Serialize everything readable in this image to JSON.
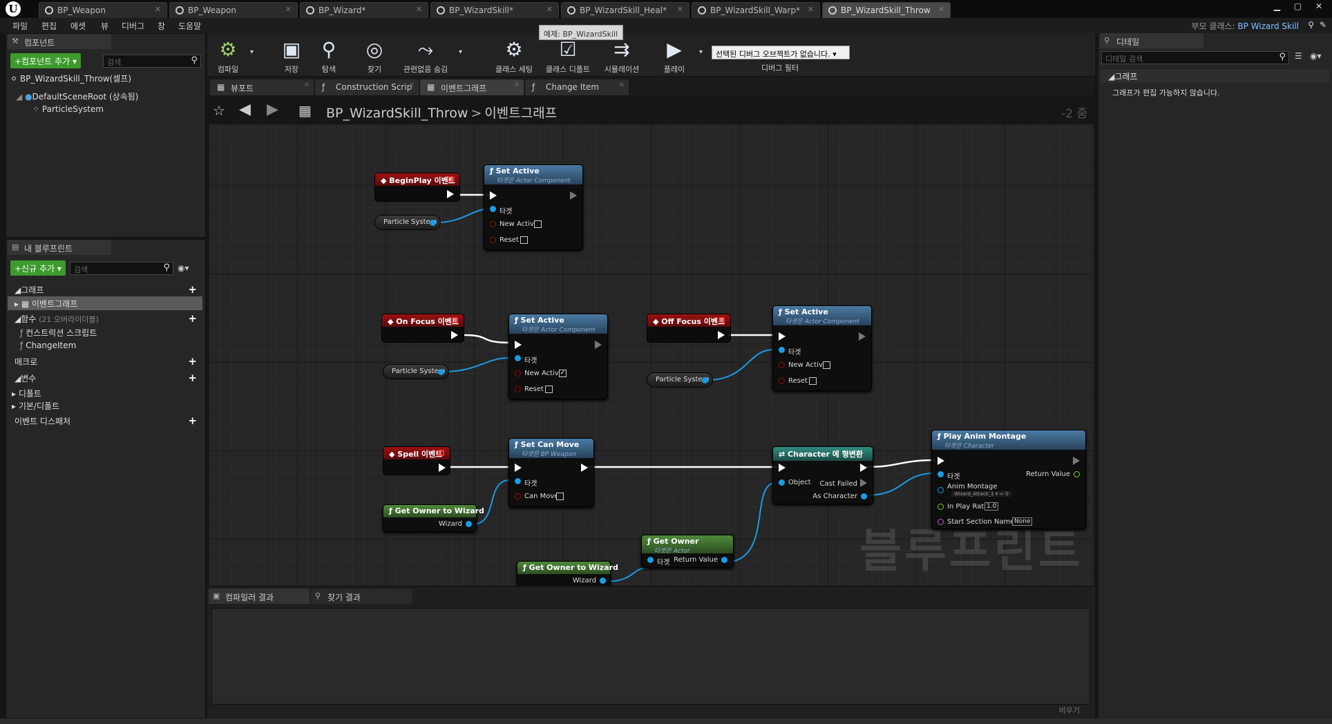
{
  "tabs": [
    {
      "label": "BP_Weapon",
      "active": false
    },
    {
      "label": "BP_Weapon",
      "active": false
    },
    {
      "label": "BP_Wizard*",
      "active": false
    },
    {
      "label": "BP_WizardSkill*",
      "active": false
    },
    {
      "label": "BP_WizardSkill_Heal*",
      "active": false
    },
    {
      "label": "BP_WizardSkill_Warp*",
      "active": false
    },
    {
      "label": "BP_WizardSkill_Throw",
      "active": true
    }
  ],
  "menu": [
    "파일",
    "편집",
    "에셋",
    "뷰",
    "디버그",
    "창",
    "도움말"
  ],
  "parent_class": {
    "label": "부모 클래스:",
    "value": "BP Wizard Skill"
  },
  "components": {
    "tab": "컴포넌트",
    "add_button": "+컴포넌트 추가",
    "search_placeholder": "검색",
    "self_item": "BP_WizardSkill_Throw(셀프)",
    "root_item": "DefaultSceneRoot (상속됨)",
    "child_item": "ParticleSystem"
  },
  "my_blueprint": {
    "tab": "내 블루프린트",
    "add_button": "+신규 추가",
    "search_placeholder": "검색",
    "graph_section": "그래프",
    "graph_item": "이벤트그래프",
    "functions_section": "함수",
    "functions_note": "(21 오버라이더블)",
    "function_items": [
      "컨스트럭션 스크립트",
      "ChangeItem"
    ],
    "macros_section": "매크로",
    "variables_section": "변수",
    "variable_groups": [
      "디폴트",
      "기본/디폴트"
    ],
    "dispatchers_section": "이벤트 디스패처"
  },
  "toolbar": {
    "compile": "컴파일",
    "save": "저장",
    "browse": "탐색",
    "find": "찾기",
    "hide_unrelated": "관련없음 숨김",
    "class_settings": "클래스 세팅",
    "class_defaults": "클래스 디폴트",
    "simulation": "시뮬레이션",
    "play": "플레이",
    "debug_select": "선택된 디버그 오브젝트가 없습니다.",
    "debug_filter": "디버그 필터",
    "tooltip": "예제: BP_WizardSkill"
  },
  "graph_tabs": [
    "뷰포트",
    "Construction Scrip",
    "이벤트그래프",
    "Change Item"
  ],
  "graph": {
    "blueprint_name": "BP_WizardSkill_Throw",
    "separator": ">",
    "graph_name": "이벤트그래프",
    "zoom": "-2 줌",
    "watermark": "블루프린트"
  },
  "nodes": {
    "beginplay": {
      "title": "BeginPlay 이벤트"
    },
    "set_active_1": {
      "title": "Set Active",
      "subtitle": "타겟은 Actor Component",
      "pins": [
        "타겟",
        "New Active",
        "Reset"
      ],
      "new_active_checked": false
    },
    "ps_var_1": {
      "title": "Particle System"
    },
    "on_focus": {
      "title": "On Focus 이벤트"
    },
    "set_active_2": {
      "title": "Set Active",
      "subtitle": "타겟은 Actor Component",
      "pins": [
        "타겟",
        "New Active",
        "Reset"
      ],
      "new_active_checked": true
    },
    "ps_var_2": {
      "title": "Particle System"
    },
    "off_focus": {
      "title": "Off Focus 이벤트"
    },
    "set_active_3": {
      "title": "Set Active",
      "subtitle": "타겟은 Actor Component",
      "pins": [
        "타겟",
        "New Active",
        "Reset"
      ],
      "new_active_checked": false
    },
    "ps_var_3": {
      "title": "Particle System"
    },
    "spell": {
      "title": "Spell 이벤트"
    },
    "set_can_move": {
      "title": "Set Can Move",
      "subtitle": "타겟은 BP Weapon",
      "pins": [
        "타겟",
        "Can Move"
      ]
    },
    "get_owner_wizard_1": {
      "title": "Get Owner to Wizard",
      "pin": "Wizard"
    },
    "cast_character": {
      "title": "Character 에 형변환",
      "pins": [
        "Object",
        "Cast Failed",
        "As Character"
      ]
    },
    "play_anim_montage": {
      "title": "Play Anim Montage",
      "subtitle": "타겟은 Character",
      "pins": [
        "타겟",
        "Anim Montage",
        "In Play Rate",
        "Start Section Name",
        "Return Value"
      ],
      "montage_value": "Wizard_Attack_1",
      "rate_value": "1.0",
      "section_value": "None"
    },
    "get_owner": {
      "title": "Get Owner",
      "subtitle": "타겟은 Actor",
      "pins": [
        "타겟",
        "Return Value"
      ]
    },
    "get_owner_wizard_2": {
      "title": "Get Owner to Wizard",
      "pin": "Wizard"
    }
  },
  "bottom": {
    "tab_compiler": "컴파일러 결과",
    "tab_find": "찾기 결과",
    "clear": "비우기"
  },
  "details": {
    "tab": "디테일",
    "search_placeholder": "디테일 검색",
    "section": "그래프",
    "message": "그래프가 편집 가능하지 않습니다."
  }
}
